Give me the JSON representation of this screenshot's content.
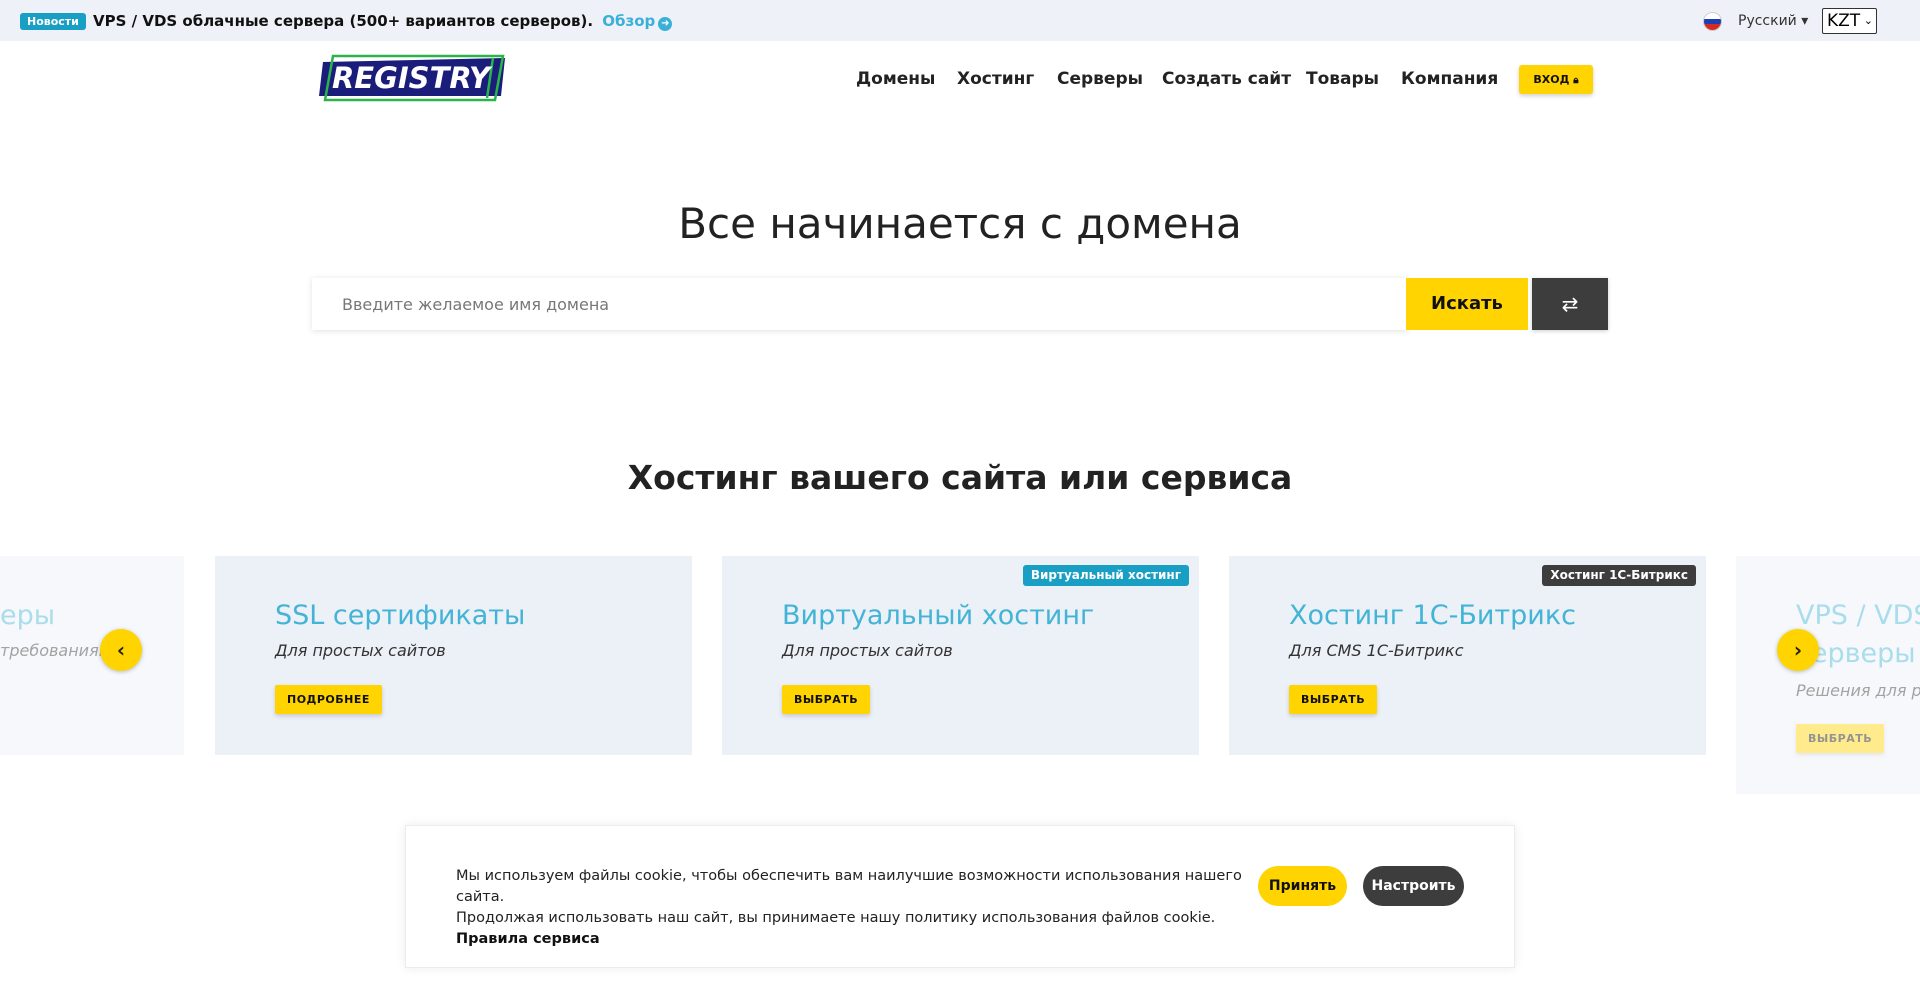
{
  "newsbar": {
    "badge": "Новости",
    "text": "VPS / VDS облачные сервера (500+ вариантов серверов).",
    "link": "Обзор",
    "link_icon": "arrow-right-circle-icon",
    "language": "Русский ▾",
    "currency": "KZT"
  },
  "header": {
    "logo_text": "REGISTRY",
    "nav": [
      "Домены",
      "Хостинг",
      "Серверы",
      "Создать сайт",
      "Товары",
      "Компания"
    ],
    "login_label": "ВХОД",
    "login_icon": "lock-icon"
  },
  "hero": {
    "title": "Все начинается с домена",
    "search_placeholder": "Введите желаемое имя домена",
    "search_button": "Искать",
    "swap_icon": "swap-arrows-icon"
  },
  "hosting": {
    "title": "Хостинг вашего сайта или сервиса",
    "cards": [
      {
        "title": "еры",
        "subtitle": "требованиям",
        "faded": true
      },
      {
        "title": "SSL сертификаты",
        "subtitle": "Для простых сайтов",
        "button": "ПОДРОБНЕЕ"
      },
      {
        "title": "Виртуальный хостинг",
        "subtitle": "Для простых сайтов",
        "button": "ВЫБРАТЬ",
        "tag": "Виртуальный хостинг",
        "tag_color": "#1a9fc4"
      },
      {
        "title": "Хостинг 1С-Битрикс",
        "subtitle": "Для CMS 1С-Битрикс",
        "button": "ВЫБРАТЬ",
        "tag": "Хостинг 1С-Битрикс",
        "tag_color": "#3d3d3d"
      },
      {
        "title": "VPS / VDS",
        "title2": "серверы",
        "subtitle": "Решения для ра",
        "button": "ВЫБРАТЬ",
        "faded": true
      }
    ],
    "prev_icon": "chevron-left-icon",
    "next_icon": "chevron-right-icon"
  },
  "cookie": {
    "line1": "Мы используем файлы cookie, чтобы обеспечить вам наилучшие возможности использования нашего сайта.",
    "line2": "Продолжая использовать наш сайт, вы принимаете нашу политику использования файлов cookie.",
    "rules": "Правила сервиса",
    "accept": "Принять",
    "configure": "Настроить"
  },
  "colors": {
    "accent": "#ffd400",
    "link": "#43b4d6",
    "dark": "#3d3d3d",
    "card_bg": "#ecf0f7"
  }
}
